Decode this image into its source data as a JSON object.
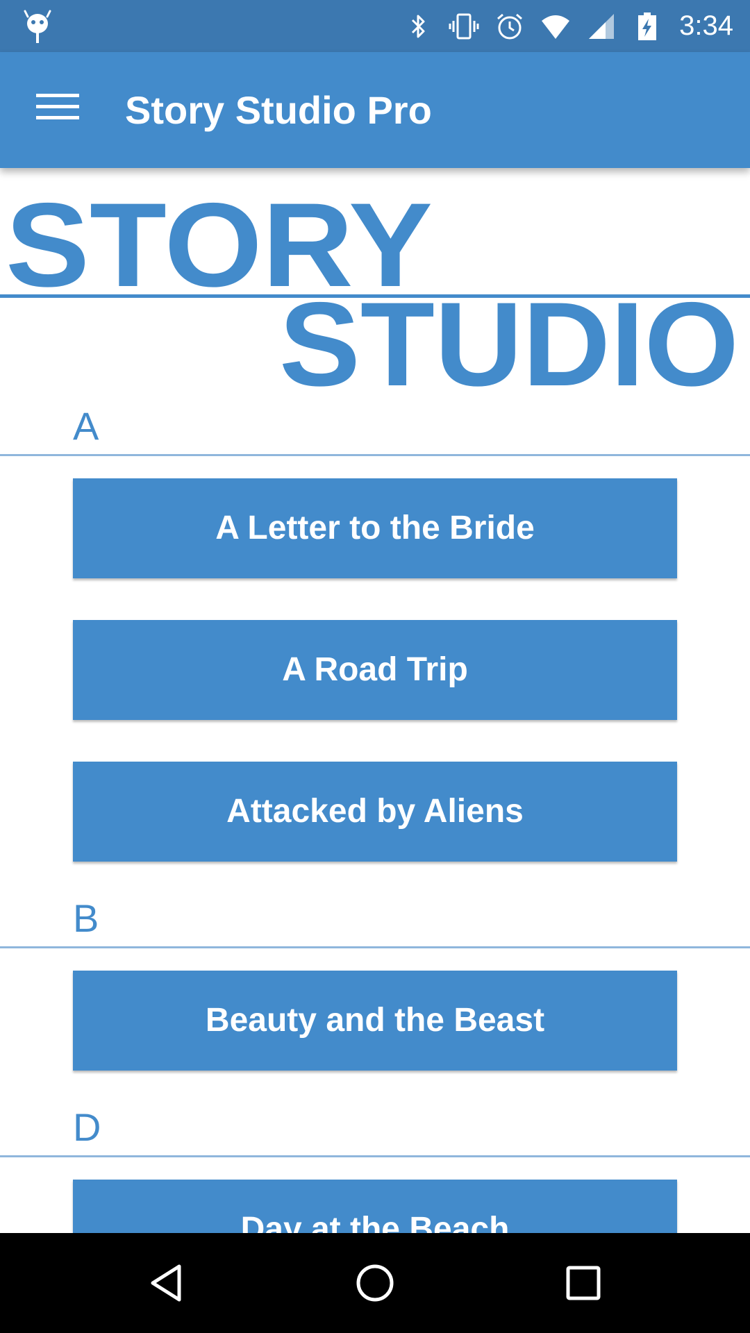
{
  "status_bar": {
    "time": "3:34",
    "icons": [
      "android-debug-icon",
      "bluetooth-icon",
      "vibrate-icon",
      "alarm-icon",
      "wifi-icon",
      "cell-signal-icon",
      "battery-charging-icon"
    ]
  },
  "app_bar": {
    "title": "Story Studio Pro",
    "menu_icon": "hamburger-menu-icon"
  },
  "logo": {
    "line1": "STORY",
    "line2": "STUDIO",
    "color": "#438bcb"
  },
  "sections": [
    {
      "letter": "A",
      "stories": [
        "A Letter to the Bride",
        "A Road Trip",
        "Attacked by Aliens"
      ]
    },
    {
      "letter": "B",
      "stories": [
        "Beauty and the Beast"
      ]
    },
    {
      "letter": "D",
      "stories": [
        "Day at the Beach"
      ]
    }
  ],
  "nav_bar": {
    "back_icon": "back-triangle-icon",
    "home_icon": "home-circle-icon",
    "recents_icon": "recents-square-icon"
  },
  "colors": {
    "primary": "#438bcb",
    "status_bar": "#3c78b0",
    "divider": "#8fb6dc"
  }
}
